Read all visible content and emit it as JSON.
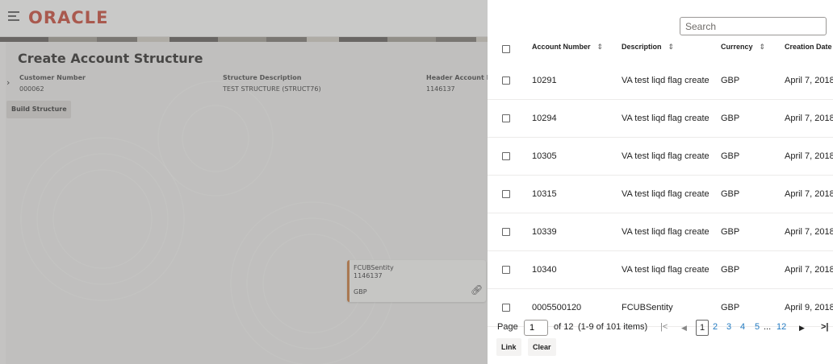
{
  "app": {
    "logo": "ORACLE",
    "page_title": "Create Account Structure",
    "fields": {
      "customer_number_label": "Customer Number",
      "customer_number_value": "000062",
      "structure_description_label": "Structure Description",
      "structure_description_value": "TEST STRUCTURE (STRUCT76)",
      "header_account_label": "Header Account N",
      "header_account_value": "1146137"
    },
    "build_structure_label": "Build Structure",
    "node": {
      "name": "FCUBSentity",
      "account": "1146137",
      "currency": "GBP"
    }
  },
  "panel": {
    "search_placeholder": "Search",
    "columns": {
      "account_number": "Account Number",
      "description": "Description",
      "currency": "Currency",
      "creation_date": "Creation Date"
    },
    "rows": [
      {
        "account": "10291",
        "description": "VA test liqd flag create",
        "currency": "GBP",
        "date": "April 7, 2018"
      },
      {
        "account": "10294",
        "description": "VA test liqd flag create",
        "currency": "GBP",
        "date": "April 7, 2018"
      },
      {
        "account": "10305",
        "description": "VA test liqd flag create",
        "currency": "GBP",
        "date": "April 7, 2018"
      },
      {
        "account": "10315",
        "description": "VA test liqd flag create",
        "currency": "GBP",
        "date": "April 7, 2018"
      },
      {
        "account": "10339",
        "description": "VA test liqd flag create",
        "currency": "GBP",
        "date": "April 7, 2018"
      },
      {
        "account": "10340",
        "description": "VA test liqd flag create",
        "currency": "GBP",
        "date": "April 7, 2018"
      },
      {
        "account": "0005500120",
        "description": "FCUBSentity",
        "currency": "GBP",
        "date": "April 9, 2018"
      }
    ],
    "pager": {
      "page_label": "Page",
      "page_value": "1",
      "of_text": "of 12",
      "items_text": "(1-9 of 101 items)",
      "current": "1",
      "pages": [
        "2",
        "3",
        "4",
        "5"
      ],
      "ellipsis": "...",
      "last": "12"
    },
    "link_label": "Link",
    "clear_label": "Clear"
  },
  "colors": {
    "brand": "#c74634",
    "link": "#227ac1",
    "node_accent": "#c9783a"
  }
}
